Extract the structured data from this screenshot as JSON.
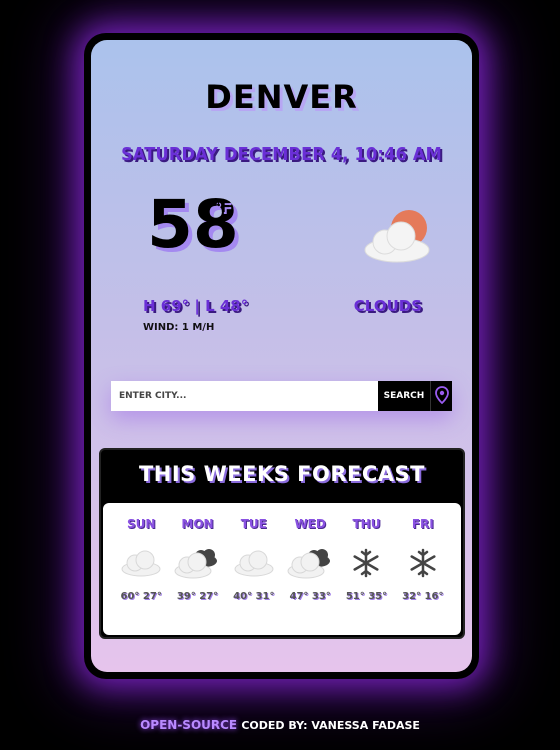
{
  "city": "Denver",
  "datetime": "Saturday December 4, 10:46 AM",
  "temperature": "58",
  "temp_unit": "°F",
  "high_low": "H 69° | L 48°",
  "wind": "Wind: 1 m/h",
  "condition": "Clouds",
  "main_icon": "partly-cloudy-sun-icon",
  "search": {
    "placeholder": "Enter City...",
    "button_label": "Search",
    "location_icon": "map-pin-icon"
  },
  "forecast": {
    "title": "This Weeks Forecast",
    "days": [
      {
        "name": "Sun",
        "temps": "60° 27°",
        "icon": "cloud-icon"
      },
      {
        "name": "Mon",
        "temps": "39° 27°",
        "icon": "dark-clouds-icon"
      },
      {
        "name": "Tue",
        "temps": "40° 31°",
        "icon": "cloud-icon"
      },
      {
        "name": "Wed",
        "temps": "47° 33°",
        "icon": "dark-clouds-icon"
      },
      {
        "name": "Thu",
        "temps": "51° 35°",
        "icon": "snowflake-icon"
      },
      {
        "name": "Fri",
        "temps": "32° 16°",
        "icon": "snowflake-icon"
      }
    ]
  },
  "footer": {
    "link_label": "Open-Source",
    "credit": "coded by: Vanessa Fadase"
  },
  "colors": {
    "accent_purple": "#6a2fd6",
    "glow": "#8c28dc"
  }
}
